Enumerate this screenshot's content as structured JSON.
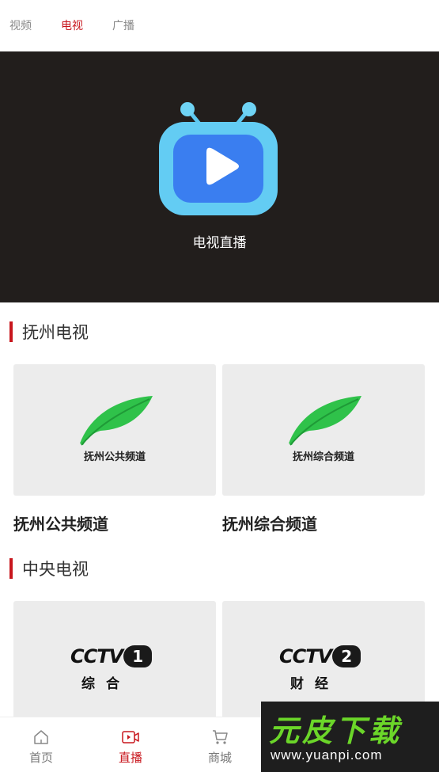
{
  "top_tabs": [
    {
      "label": "视频",
      "active": false
    },
    {
      "label": "电视",
      "active": true
    },
    {
      "label": "广播",
      "active": false
    }
  ],
  "hero": {
    "icon": "tv-play-icon",
    "label": "电视直播",
    "background": "#221e1c"
  },
  "sections": [
    {
      "title": "抚州电视",
      "cards": [
        {
          "title": "抚州公共频道",
          "thumb_caption": "抚州公共频道",
          "logo": "leaf-logo-icon"
        },
        {
          "title": "抚州综合频道",
          "thumb_caption": "抚州综合频道",
          "logo": "leaf-logo-icon"
        }
      ]
    },
    {
      "title": "中央电视",
      "cards": [
        {
          "logo_text": "CCTV",
          "logo_number": "1",
          "logo_sub": "综合"
        },
        {
          "logo_text": "CCTV",
          "logo_number": "2",
          "logo_sub": "财经"
        }
      ]
    }
  ],
  "bottom_nav": [
    {
      "label": "首页",
      "icon": "home-icon",
      "active": false
    },
    {
      "label": "直播",
      "icon": "live-video-icon",
      "active": true
    },
    {
      "label": "商城",
      "icon": "cart-icon",
      "active": false
    }
  ],
  "watermark": {
    "title": "元皮下载",
    "url": "www.yuanpi.com"
  },
  "colors": {
    "accent": "#c8161d",
    "leaf_green": "#2fc24a",
    "watermark_green": "#6bd629"
  }
}
